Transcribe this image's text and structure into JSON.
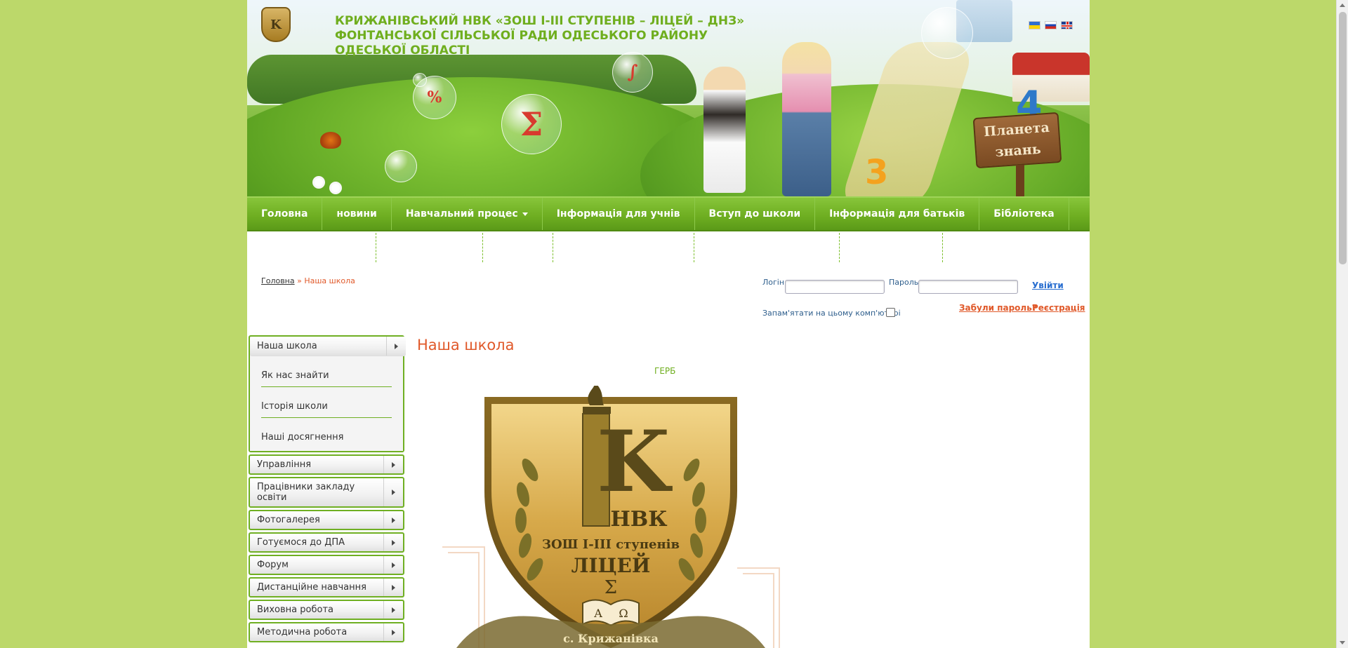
{
  "header": {
    "school_title": "КРИЖАНІВСЬКИЙ НВК «ЗОШ І-ІІІ СТУПЕНІВ – ЛІЦЕЙ – ДНЗ» ФОНТАНСЬКОЇ СІЛЬСЬКОЇ РАДИ ОДЕСЬКОГО РАЙОНУ ОДЕСЬКОЇ ОБЛАСТІ",
    "logo_letter": "K",
    "sign_text": "Планета знань",
    "bubble_percent": "%",
    "bubble_sigma": "Σ",
    "bubble_integral": "∫",
    "number_four": "4",
    "number_three": "3"
  },
  "nav": {
    "items": [
      {
        "label": "Головна"
      },
      {
        "label": "новини"
      },
      {
        "label": "Навчальний процес"
      },
      {
        "label": "Інформація для учнів"
      },
      {
        "label": "Вступ до школи"
      },
      {
        "label": "Інформація для батьків"
      },
      {
        "label": "Бібліотека"
      }
    ]
  },
  "breadcrumb": {
    "home": "Головна",
    "separator": "»",
    "current": "Наша школа"
  },
  "login": {
    "login_label": "Логін",
    "password_label": "Пароль",
    "submit_label": "Увійти",
    "remember_label": "Запам'ятати на цьому комп'ютері",
    "forgot_label": "Забули пароль?",
    "register_label": "Реєстрація"
  },
  "sidebar": {
    "open_item": "Наша школа",
    "open_subitems": [
      "Як нас знайти",
      "Історія школи",
      "Наші досягнення"
    ],
    "items": [
      {
        "label": "Управління"
      },
      {
        "label": "Працівники закладу освіти"
      },
      {
        "label": "Фотогалерея"
      },
      {
        "label": "Готуємося до ДПА"
      },
      {
        "label": "Форум"
      },
      {
        "label": "Дистанційне навчання"
      },
      {
        "label": "Виховна робота"
      },
      {
        "label": "Методична робота"
      }
    ]
  },
  "content": {
    "title": "Наша школа",
    "emblem_caption": "ГЕРБ",
    "emblem": {
      "letter": "K",
      "line1": "НВК",
      "line2": "ЗОШ І-ІІІ ступенів",
      "line3": "ЛІЦЕЙ",
      "symbol_sigma": "Σ",
      "symbol_alpha": "А",
      "symbol_omega": "Ω",
      "ribbon_text": "с. Крижанівка"
    }
  },
  "colors": {
    "page_background": "#bcd86a",
    "accent_green": "#6fae1e",
    "accent_orange": "#e0592a",
    "link_blue": "#2a6fd0"
  }
}
